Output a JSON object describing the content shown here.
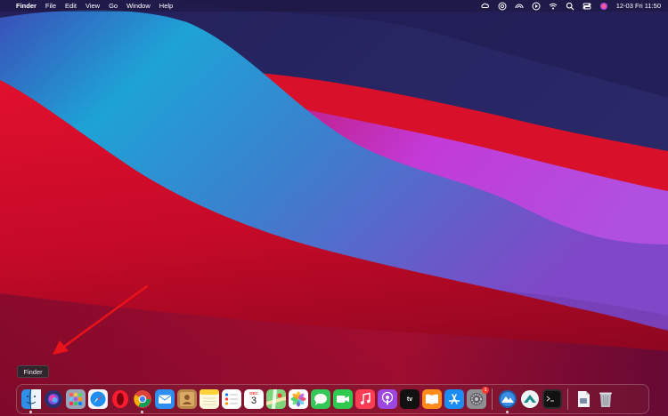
{
  "menubar": {
    "apple_glyph": "",
    "app_name": "Finder",
    "menus": [
      "File",
      "Edit",
      "View",
      "Go",
      "Window",
      "Help"
    ],
    "clock": "12-03 Fri  11:50"
  },
  "tooltip": {
    "label": "Finder"
  },
  "dock": {
    "calendar": {
      "month": "DEC",
      "day": "3"
    },
    "settings_badge": "1",
    "tv_label": "tv"
  }
}
